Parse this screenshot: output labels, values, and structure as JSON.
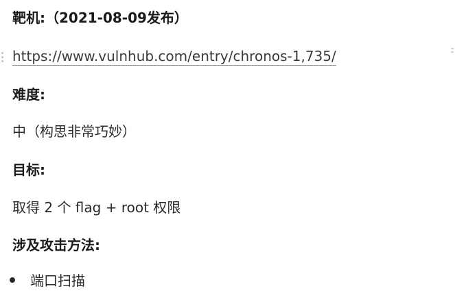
{
  "target": {
    "heading": "靶机:（2021-08-09发布）",
    "url": "https://www.vulnhub.com/entry/chronos-1,735/"
  },
  "difficulty": {
    "heading": "难度:",
    "value": "中（构思非常巧妙）"
  },
  "goal": {
    "heading": "目标:",
    "value": "取得 2 个 flag + root 权限"
  },
  "methods": {
    "heading": "涉及攻击方法:",
    "items": [
      "端口扫描"
    ]
  }
}
